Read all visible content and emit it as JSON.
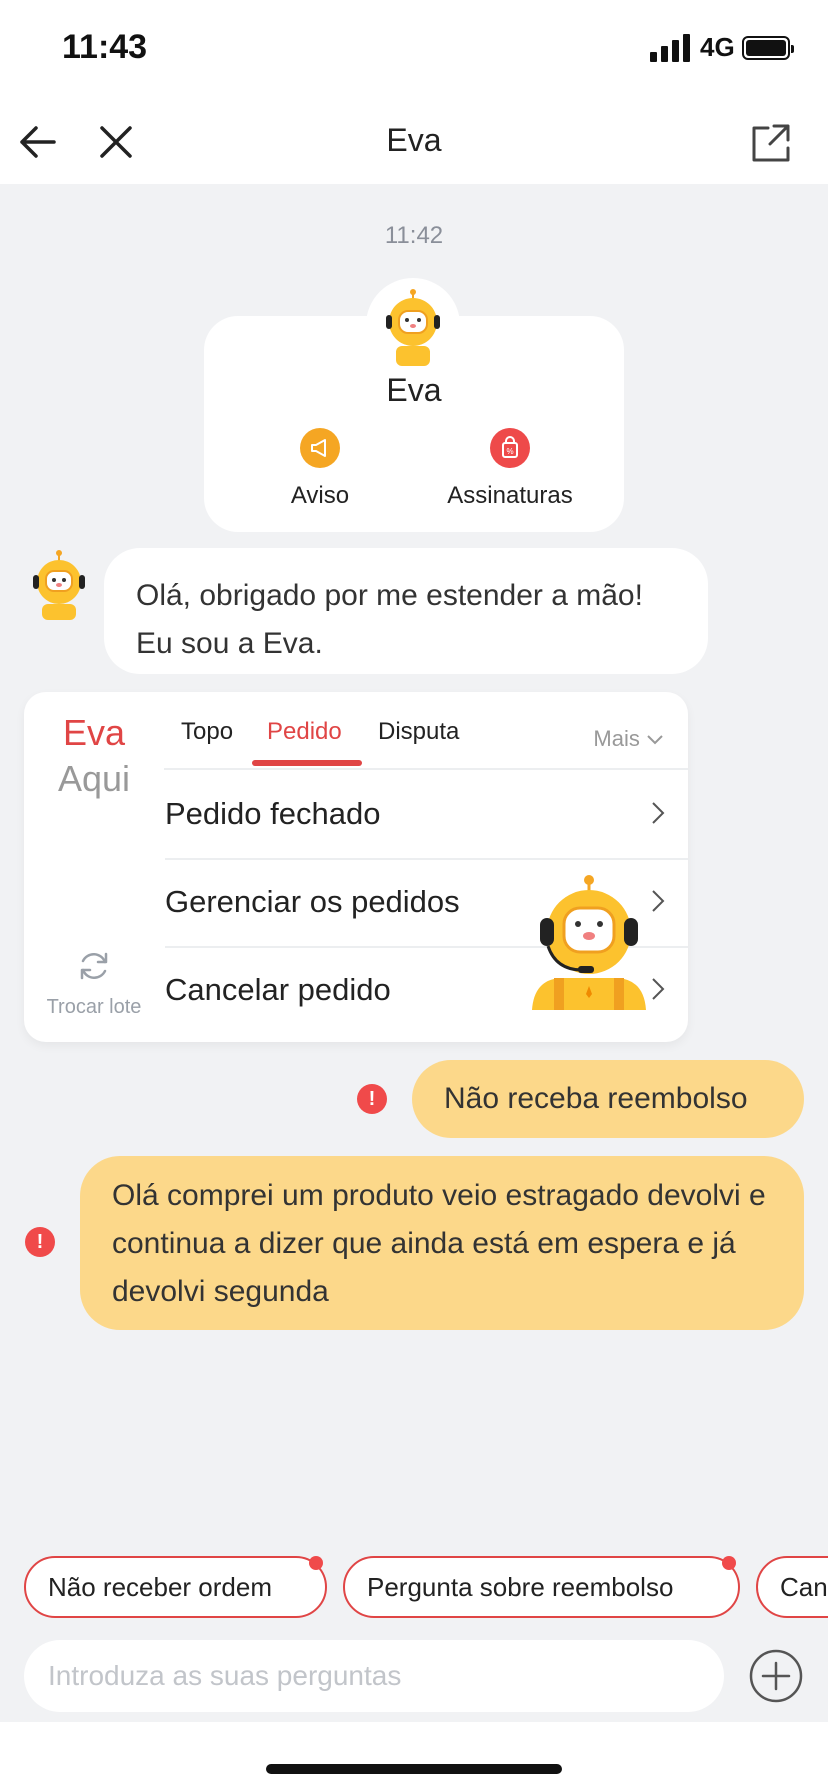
{
  "status": {
    "time": "11:43",
    "network": "4G"
  },
  "nav": {
    "title": "Eva"
  },
  "chat": {
    "timestamp": "11:42",
    "profile": {
      "name": "Eva",
      "actions": [
        {
          "label": "Aviso"
        },
        {
          "label": "Assinaturas"
        }
      ]
    },
    "bot_message": "Olá, obrigado por me estender a mão! Eu sou a Eva.",
    "panel": {
      "brand": [
        "Eva",
        "Aqui"
      ],
      "tabs": [
        "Topo",
        "Pedido",
        "Disputa"
      ],
      "more": "Mais",
      "items": [
        "Pedido fechado",
        "Gerenciar os pedidos",
        "Cancelar pedido"
      ],
      "refresh": "Trocar lote"
    },
    "user_messages": [
      "Não receba reembolso",
      "Olá comprei um produto veio estragado devolvi e continua a dizer que ainda está em espera e já devolvi segunda"
    ]
  },
  "suggestions": [
    "Não receber ordem",
    "Pergunta sobre reembolso",
    "Can"
  ],
  "input": {
    "placeholder": "Introduza as suas perguntas"
  },
  "colors": {
    "accent": "#e04545",
    "user_bubble": "#fcd88a",
    "aviso": "#f5a623",
    "assinaturas": "#ee4a4a"
  }
}
